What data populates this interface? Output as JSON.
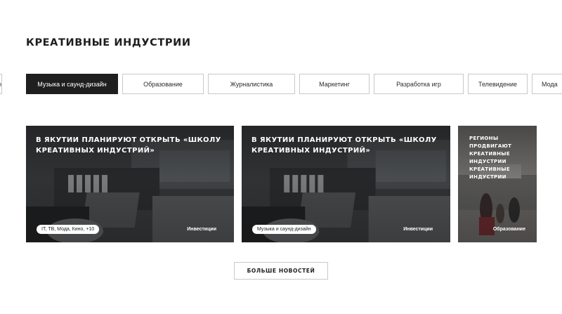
{
  "section": {
    "title": "КРЕАТИВНЫЕ ИНДУСТРИИ"
  },
  "tabs": [
    {
      "label": "о",
      "active": false
    },
    {
      "label": "Музыка и саунд-дизайн",
      "active": true
    },
    {
      "label": "Образование",
      "active": false
    },
    {
      "label": "Журналистика",
      "active": false
    },
    {
      "label": "Маркетинг",
      "active": false
    },
    {
      "label": "Разработка игр",
      "active": false
    },
    {
      "label": "Телевидение",
      "active": false
    },
    {
      "label": "Мода",
      "active": false
    }
  ],
  "cards": [
    {
      "title": "В Якутии планируют открыть «Школу креативных индустрий»",
      "tag": "IT, ТВ, Мода, Кино, +10",
      "category": "Инвестиции"
    },
    {
      "title": "В Якутии планируют открыть «Школу креативных индустрий»",
      "tag": "Музыка и саунд-дизайн",
      "category": "Инвестиции"
    },
    {
      "title": "Регионы продвигают креативные индустрии креативные индустрии",
      "category": "Образование"
    }
  ],
  "more_button": {
    "label": "БОЛЬШЕ НОВОСТЕЙ"
  }
}
